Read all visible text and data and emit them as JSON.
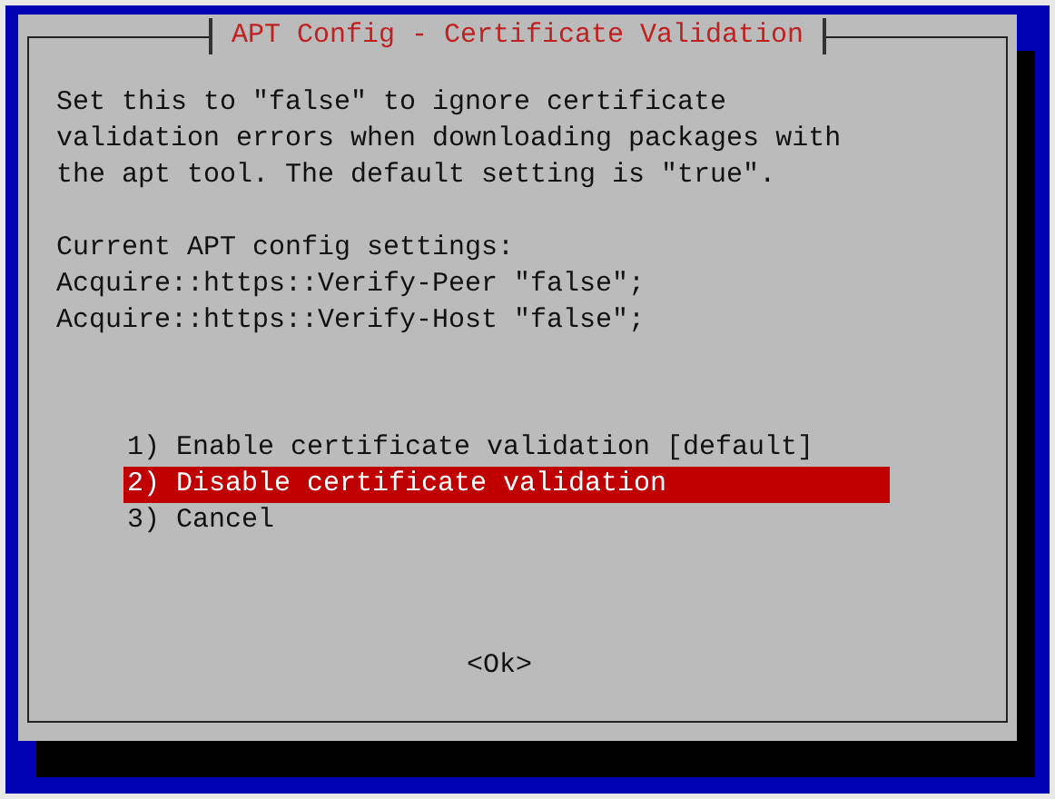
{
  "dialog": {
    "title": "APT Config - Certificate Validation",
    "description": [
      "Set this to \"false\" to ignore certificate",
      "validation errors when downloading packages with",
      "the apt tool. The default setting is \"true\"."
    ],
    "settings_heading": "Current APT config settings:",
    "settings": [
      "Acquire::https::Verify-Peer \"false\";",
      "Acquire::https::Verify-Host \"false\";"
    ],
    "menu": [
      {
        "label": "1) Enable certificate validation [default]",
        "selected": false
      },
      {
        "label": "2) Disable certificate validation",
        "selected": true
      },
      {
        "label": "3) Cancel",
        "selected": false
      }
    ],
    "button": "<Ok>"
  }
}
